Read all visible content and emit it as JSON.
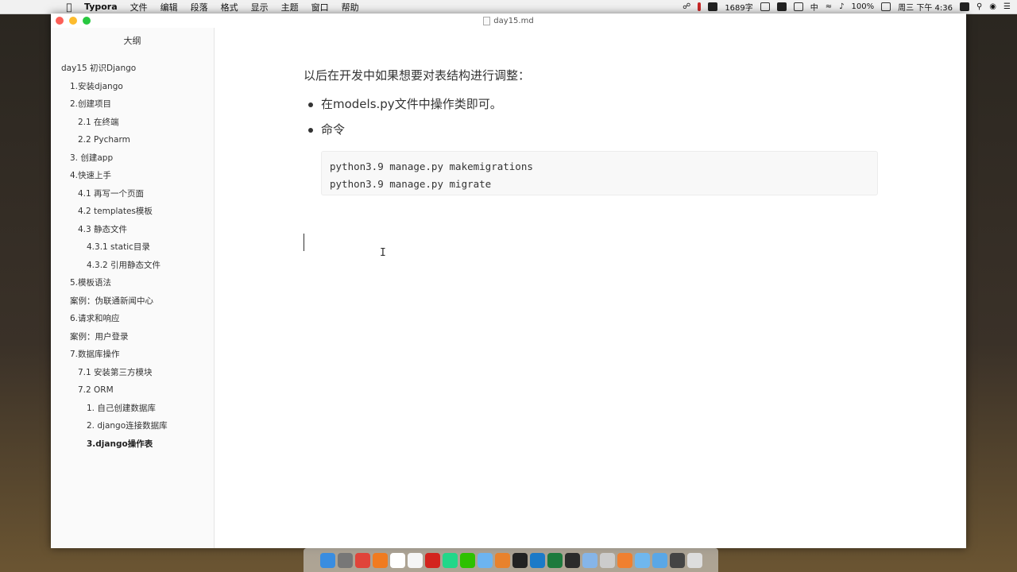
{
  "menubar": {
    "app_name": "Typora",
    "menus": [
      "文件",
      "编辑",
      "段落",
      "格式",
      "显示",
      "主题",
      "窗口",
      "帮助"
    ],
    "word_count": "1689字",
    "ime": "中",
    "battery": "100%",
    "clock": "周三 下午 4:36"
  },
  "window": {
    "title": "day15.md"
  },
  "sidebar": {
    "title": "大纲",
    "items": [
      {
        "label": "day15 初识Django",
        "level": 1
      },
      {
        "label": "1.安装django",
        "level": 2
      },
      {
        "label": "2.创建项目",
        "level": 2
      },
      {
        "label": "2.1 在终端",
        "level": 3
      },
      {
        "label": "2.2 Pycharm",
        "level": 3
      },
      {
        "label": "3. 创建app",
        "level": 2
      },
      {
        "label": "4.快速上手",
        "level": 2
      },
      {
        "label": "4.1 再写一个页面",
        "level": 3
      },
      {
        "label": "4.2 templates模板",
        "level": 3
      },
      {
        "label": "4.3 静态文件",
        "level": 3
      },
      {
        "label": "4.3.1 static目录",
        "level": 4
      },
      {
        "label": "4.3.2 引用静态文件",
        "level": 4
      },
      {
        "label": "5.模板语法",
        "level": 2
      },
      {
        "label": "案例：伪联通新闻中心",
        "level": 2
      },
      {
        "label": "6.请求和响应",
        "level": 2
      },
      {
        "label": "案例：用户登录",
        "level": 2
      },
      {
        "label": "7.数据库操作",
        "level": 2
      },
      {
        "label": "7.1 安装第三方模块",
        "level": 3
      },
      {
        "label": "7.2 ORM",
        "level": 3
      },
      {
        "label": "1. 自己创建数据库",
        "level": 4
      },
      {
        "label": "2. django连接数据库",
        "level": 4
      },
      {
        "label": "3.django操作表",
        "level": 4,
        "active": true
      }
    ]
  },
  "editor": {
    "paragraph": "以后在开发中如果想要对表结构进行调整：",
    "bullets": [
      "在models.py文件中操作类即可。",
      "命令"
    ],
    "code_lines": [
      "python3.9 manage.py makemigrations",
      "python3.9 manage.py migrate"
    ]
  },
  "dock": {
    "icons": [
      "finder-icon",
      "launchpad-icon",
      "chrome-icon",
      "firefox-icon",
      "typora-icon",
      "calendar-icon",
      "netease-music-icon",
      "pycharm-icon",
      "wechat-icon",
      "preview-icon",
      "sublime-icon",
      "terminal-icon",
      "vscode-icon",
      "excel-icon",
      "screen-record-icon",
      "network-icon",
      "paperclip-icon",
      "app-icon",
      "folder-icon",
      "folder-icon-2",
      "keyboard-icon",
      "trash-icon"
    ],
    "colors": [
      "#3a8de0",
      "#777777",
      "#e0443a",
      "#f07b20",
      "#ffffff",
      "#f5f5f5",
      "#d3241e",
      "#21d789",
      "#2dc100",
      "#6cb4f0",
      "#e8822c",
      "#222222",
      "#1b7ac8",
      "#1d7a3d",
      "#2b2b2b",
      "#86b5e8",
      "#cccccc",
      "#f08030",
      "#6fb7ee",
      "#5aa7e6",
      "#444444",
      "#dddddd"
    ]
  }
}
